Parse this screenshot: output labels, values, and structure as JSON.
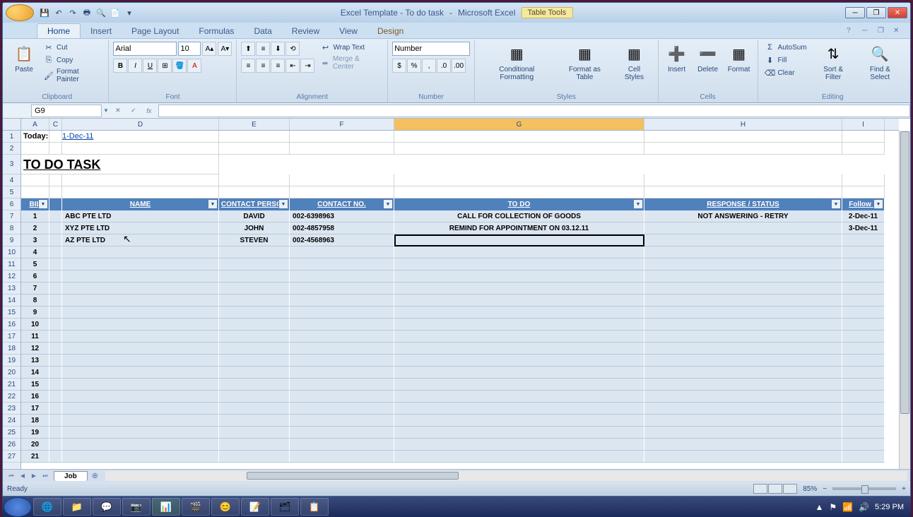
{
  "title": {
    "doc": "Excel Template - To do task",
    "app": "Microsoft Excel",
    "tool_tab": "Table Tools"
  },
  "qat": [
    "save",
    "undo",
    "redo",
    "print",
    "preview",
    "new",
    "open"
  ],
  "ribbon_tabs": [
    "Home",
    "Insert",
    "Page Layout",
    "Formulas",
    "Data",
    "Review",
    "View",
    "Design"
  ],
  "clipboard": {
    "paste": "Paste",
    "cut": "Cut",
    "copy": "Copy",
    "fp": "Format Painter",
    "label": "Clipboard"
  },
  "font": {
    "name": "Arial",
    "size": "10",
    "label": "Font"
  },
  "alignment": {
    "wrap": "Wrap Text",
    "merge": "Merge & Center",
    "label": "Alignment"
  },
  "number": {
    "format": "Number",
    "label": "Number"
  },
  "styles": {
    "cf": "Conditional\nFormatting",
    "fat": "Format\nas Table",
    "cs": "Cell\nStyles",
    "label": "Styles"
  },
  "cells": {
    "insert": "Insert",
    "delete": "Delete",
    "format": "Format",
    "label": "Cells"
  },
  "editing": {
    "autosum": "AutoSum",
    "fill": "Fill",
    "clear": "Clear",
    "sort": "Sort &\nFilter",
    "find": "Find &\nSelect",
    "label": "Editing"
  },
  "name_box": "G9",
  "columns": [
    "A",
    "C",
    "D",
    "E",
    "F",
    "G",
    "H",
    "I"
  ],
  "col_widths": [
    "cA",
    "cC",
    "cD",
    "cE",
    "cF",
    "cG",
    "cH",
    "cI"
  ],
  "active_col": "G",
  "today_label": "Today:",
  "today_value": "1-Dec-11",
  "title_text": "TO DO TASK",
  "headers": [
    "BIL",
    "",
    "NAME",
    "CONTACT PERSON",
    "CONTACT NO.",
    "TO DO",
    "RESPONSE / STATUS",
    "Follow u"
  ],
  "rows": [
    {
      "bil": "1",
      "name": "ABC PTE LTD",
      "person": "DAVID",
      "contact": "002-6398963",
      "todo": "CALL FOR COLLECTION OF GOODS",
      "status": "NOT ANSWERING - RETRY",
      "follow": "2-Dec-11"
    },
    {
      "bil": "2",
      "name": "XYZ PTE LTD",
      "person": "JOHN",
      "contact": "002-4857958",
      "todo": "REMIND FOR APPOINTMENT ON 03.12.11",
      "status": "",
      "follow": "3-Dec-11"
    },
    {
      "bil": "3",
      "name": "AZ PTE LTD",
      "person": "STEVEN",
      "contact": "002-4568963",
      "todo": "",
      "status": "",
      "follow": ""
    }
  ],
  "empty_bils": [
    "4",
    "5",
    "6",
    "7",
    "8",
    "9",
    "10",
    "11",
    "12",
    "13",
    "14",
    "15",
    "16",
    "17",
    "18",
    "19",
    "20",
    "21"
  ],
  "sheet": "Job",
  "status": "Ready",
  "zoom": "85%",
  "clock": "5:29 PM"
}
